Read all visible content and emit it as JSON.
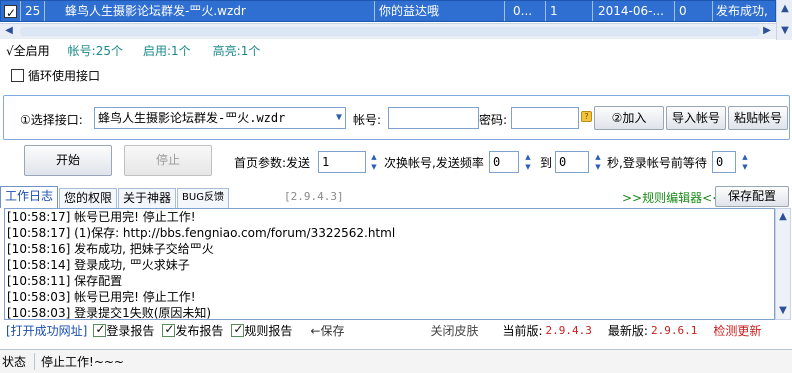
{
  "grid": {
    "row": {
      "checked": true,
      "index": "25",
      "name": "蜂鸟人生摄影论坛群发-罒火.wzdr",
      "nickname": "你的益达哦",
      "col4": "0...",
      "col5": "1",
      "date": "2014-06-...",
      "col7": "0",
      "status": "发布成功,"
    }
  },
  "stats": {
    "check_all": "√全启用",
    "accounts_label": "帐号:",
    "accounts_value": "25个",
    "enabled_label": "启用:",
    "enabled_value": "1个",
    "highlight_label": "高亮:",
    "highlight_value": "1个"
  },
  "loop_interface": {
    "label": "循环使用接口",
    "checked": false
  },
  "interface": {
    "select_label": "①选择接口:",
    "selected": "蜂鸟人生摄影论坛群发-罒火.wzdr",
    "account_label": "帐号:",
    "account_value": "",
    "password_label": "密码:",
    "password_value": "",
    "add_button": "②加入",
    "import_button": "导入帐号",
    "paste_button": "粘贴帐号"
  },
  "controls": {
    "start_button": "开始",
    "stop_button": "停止",
    "home_param_label": "首页参数:发送",
    "send_count": "1",
    "switch_label": "次换帐号,发送频率",
    "freq_from": "0",
    "to_label": "到",
    "freq_to": "0",
    "wait_label": "秒,登录帐号前等待",
    "wait_value": "0"
  },
  "tabs": [
    {
      "label": "工作日志",
      "active": true
    },
    {
      "label": "您的权限",
      "active": false
    },
    {
      "label": "关于神器",
      "active": false
    },
    {
      "label": "BUG反馈",
      "active": false
    }
  ],
  "version_tag": "[2.9.4.3]",
  "rules_editor": ">>规则编辑器<<",
  "save_config": "保存配置",
  "log": [
    "[10:58:17] 帐号已用完! 停止工作!",
    "[10:58:17] (1)保存: http://bbs.fengniao.com/forum/3322562.html",
    "[10:58:16] 发布成功, 把妹子交给罒火",
    "[10:58:14] 登录成功, 罒火求妹子",
    "[10:58:11] 保存配置",
    "[10:58:03] 帐号已用完! 停止工作!",
    "[10:58:03] 登录提交1失败(原因未知)"
  ],
  "bottom": {
    "open_success": "[打开成功网址]",
    "login_report": "登录报告",
    "publish_report": "发布报告",
    "rule_report": "规则报告",
    "save_arrow": "←保存",
    "close_skin": "关闭皮肤",
    "current_label": "当前版:",
    "current_version": "2.9.4.3",
    "latest_label": "最新版:",
    "latest_version": "2.9.6.1",
    "check_update": "检测更新"
  },
  "statusbar": {
    "label": "状态",
    "message": "停止工作!~~~"
  },
  "colors": {
    "selection": "#2f6fd1",
    "teal": "#1c8a8a",
    "green": "#1b8a1b",
    "red": "#c81e1e",
    "link_blue": "#1a4fb0"
  }
}
